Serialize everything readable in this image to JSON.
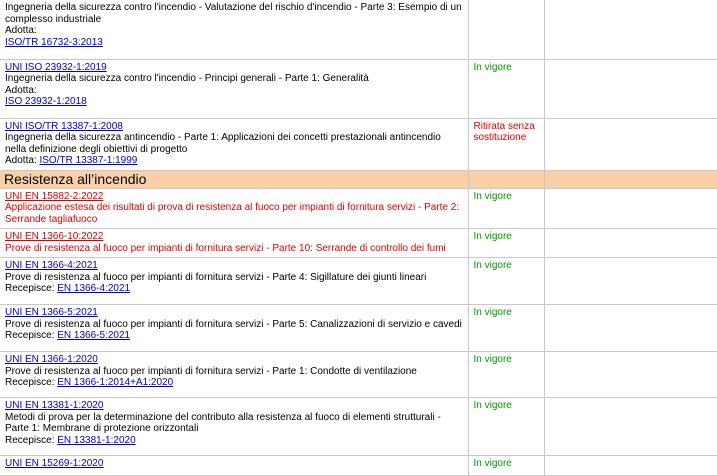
{
  "rows_top": [
    {
      "code": "",
      "title": "Ingegneria della sicurezza contro l'incendio - Valutazione del rischio d'incendio - Parte 3: Esempio di un complesso industriale",
      "ref_label": "Adotta:",
      "ref_code": "ISO/TR 16732-3:2013",
      "status": ""
    },
    {
      "code": "UNI ISO 23932-1:2019",
      "title": "Ingegneria della sicurezza contro l'incendio - Principi generali - Parte 1: Generalità",
      "ref_label": "Adotta:",
      "ref_code": "ISO 23932-1:2018",
      "status": "In vigore"
    },
    {
      "code": "UNI ISO/TR 13387-1:2008",
      "title": "Ingegneria della sicurezza antincendio - Parte 1: Applicazioni dei concetti prestazionali antincendio nella definizione degli obiettivi di progetto",
      "ref_label": "Adotta:",
      "ref_code": "ISO/TR 13387-1:1999",
      "status": "Ritirata senza sostituzione"
    }
  ],
  "section_title": "Resistenza all’incendio",
  "rows_section": [
    {
      "code": "UNI EN 15882-2:2022",
      "title": "Applicazione estesa dei risultati di prova di resistenza al fuoco per impianti di fornitura servizi - Parte 2: Serrande tagliafuoco",
      "ref_label": "",
      "ref_code": "",
      "status": "In vigore"
    },
    {
      "code": "UNI EN 1366-10:2022",
      "title": "Prove di resistenza al fuoco per impianti di fornitura servizi - Parte 10: Serrande di controllo dei fumi",
      "ref_label": "",
      "ref_code": "",
      "status": "In vigore"
    },
    {
      "code": "UNI EN 1366-4:2021",
      "title": "Prove di resistenza al fuoco per impianti di fornitura servizi - Parte 4: Sigillature dei giunti lineari",
      "ref_label": "Recepisce:",
      "ref_code": "EN 1366-4:2021",
      "status": "In vigore"
    },
    {
      "code": "UNI EN 1366-5:2021",
      "title": "Prove di resistenza al fuoco per impianti di fornitura servizi - Parte 5: Canalizzazioni di servizio e cavedi",
      "ref_label": "Recepisce:",
      "ref_code": "EN 1366-5:2021",
      "status": "In vigore"
    },
    {
      "code": "UNI EN 1366-1:2020",
      "title": "Prove di resistenza al fuoco per impianti di fornitura servizi - Parte 1: Condotte di ventilazione",
      "ref_label": "Recepisce:",
      "ref_code": "EN 1366-1:2014+A1:2020",
      "status": "In vigore"
    },
    {
      "code": "UNI EN 13381-1:2020",
      "title": "Metodi di prova per la determinazione del contributo alla resistenza al fuoco di elementi strutturali - Parte 1: Membrane di protezione orizzontali",
      "ref_label": "Recepisce:",
      "ref_code": "EN 13381-1:2020",
      "status": "In vigore"
    },
    {
      "code": "UNI EN 15269-1:2020",
      "title": "",
      "ref_label": "",
      "ref_code": "",
      "status": "In vigore"
    }
  ]
}
